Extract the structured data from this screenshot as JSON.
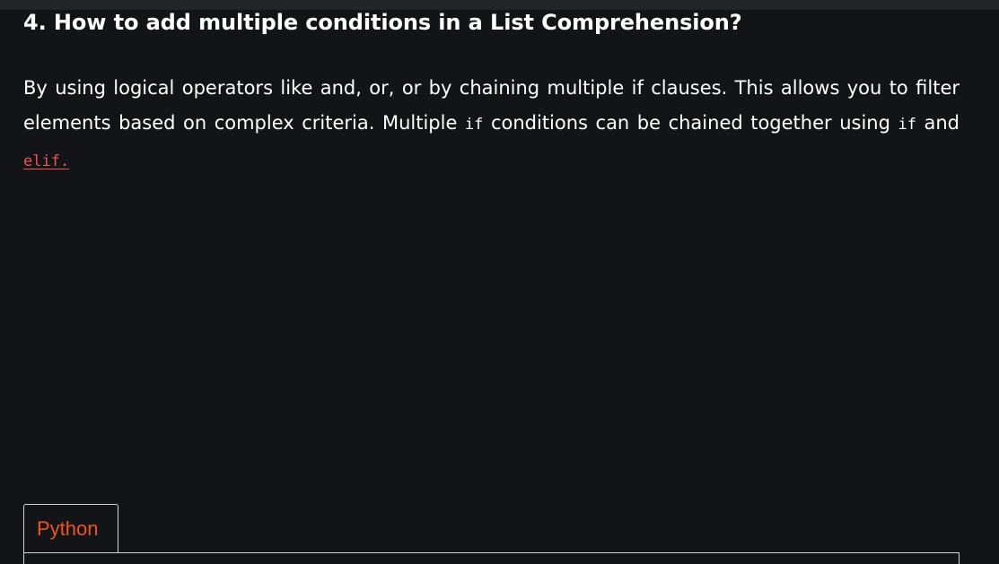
{
  "article": {
    "heading": "4. How to add multiple conditions in a List Comprehension?",
    "paragraph": {
      "text_1": "By using logical operators like and, or, or by chaining multiple if clauses. This allows you to filter elements based on complex criteria. Multiple ",
      "code_1": "if",
      "text_2": " conditions can be chained together using ",
      "code_2": "if",
      "text_3": " and ",
      "link_code": "elif.",
      "link_color": "#f0544f"
    }
  },
  "code_block": {
    "tabs": [
      {
        "label": "Python",
        "active": true,
        "color": "#f0541e"
      }
    ]
  },
  "colors": {
    "background": "#131417",
    "top_strip": "#232428",
    "text": "#ffffff",
    "border": "#d4d4d4"
  }
}
